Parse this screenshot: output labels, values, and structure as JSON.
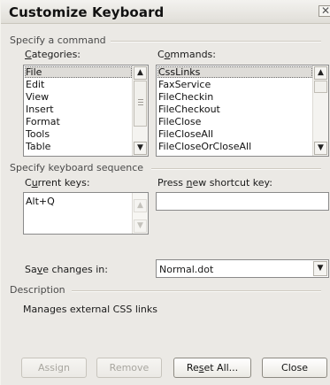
{
  "dialog": {
    "title": "Customize Keyboard"
  },
  "command_section": {
    "label": "Specify a command",
    "categories": {
      "label_pre": "",
      "label_access": "C",
      "label_post": "ategories:",
      "items": [
        "File",
        "Edit",
        "View",
        "Insert",
        "Format",
        "Tools",
        "Table"
      ],
      "selected": "File"
    },
    "commands": {
      "label_pre": "C",
      "label_access": "o",
      "label_post": "mmands:",
      "items": [
        "CssLinks",
        "FaxService",
        "FileCheckin",
        "FileCheckout",
        "FileClose",
        "FileCloseAll",
        "FileCloseOrCloseAll"
      ],
      "selected": "CssLinks"
    }
  },
  "sequence_section": {
    "label": "Specify keyboard sequence",
    "current_keys": {
      "label_pre": "C",
      "label_access": "u",
      "label_post": "rrent keys:",
      "items": [
        "Alt+Q"
      ]
    },
    "new_shortcut": {
      "label_pre": "Press ",
      "label_access": "n",
      "label_post": "ew shortcut key:",
      "value": ""
    }
  },
  "save_changes": {
    "label_pre": "Sa",
    "label_access": "v",
    "label_post": "e changes in:",
    "value": "Normal.dot"
  },
  "description_section": {
    "label": "Description",
    "text": "Manages external CSS links"
  },
  "buttons": {
    "assign": "Assign",
    "remove": "Remove",
    "reset_pre": "Re",
    "reset_access": "s",
    "reset_post": "et All...",
    "close": "Close"
  },
  "icons": {
    "close": "close-icon",
    "scroll_up": "chevron-up-icon",
    "scroll_down": "chevron-down-icon",
    "dropdown": "chevron-down-icon"
  }
}
